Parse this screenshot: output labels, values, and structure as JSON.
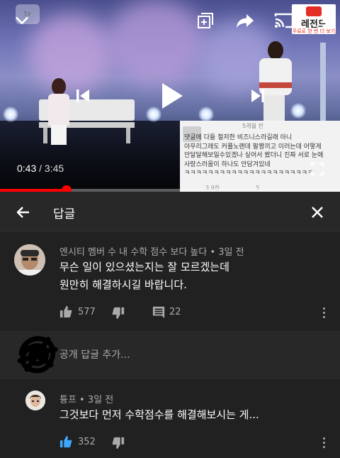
{
  "player": {
    "channel_logo_text": "tv",
    "channel_badge": {
      "name": "레전드",
      "sub": "무료로 한 번 더 보기"
    },
    "current_time": "0:43",
    "separator": " / ",
    "duration": "3:45",
    "progress_fraction": 0.196,
    "icons": {
      "collapse": "chevron-down-icon",
      "add_to_playlist": "playlist-add-icon",
      "share": "share-icon",
      "cast": "cast-icon",
      "more": "more-vertical-icon",
      "previous": "skip-previous-icon",
      "play": "play-icon",
      "next": "skip-next-icon",
      "fullscreen": "fullscreen-icon"
    },
    "screenshot_comment": {
      "time": "5개월 전",
      "lines": [
        "댓글에 다들 철저한 비즈니스라길래 아니",
        "아무리그래도 커플노랜데 팔짱끼고 이러는데 어떻게",
        "안달달해보일수있겠나 싶어서 봤더니 진짜 서로 눈에",
        "사랑스러움이 하나도 안담겨있네",
        "ㅋㅋㅋㅋㅋㅋㅋㅋㅋㅋㅋㅋㅋㅋㅋㅋㅋㅋㅋㅋㅋㅋ"
      ],
      "likes": "3.9천",
      "replies": "5"
    }
  },
  "reply_panel": {
    "title": "답글",
    "back_icon": "back-arrow-icon",
    "close_icon": "close-icon"
  },
  "top_comment": {
    "author": "엔시티 멤버 수 내 수학 점수 보다 높다",
    "time": "3일 전",
    "meta_sep": " • ",
    "lines": [
      "무슨 일이 있으셨는지는 잘 모르겠는데",
      "원만히 해결하시길 바랍니다."
    ],
    "likes": "577",
    "replies": "22"
  },
  "add_reply": {
    "placeholder": "공개 답글 추가..."
  },
  "reply": {
    "author": "튱프",
    "time": "3일 전",
    "meta_sep": " • ",
    "text": "그것보다 먼저 수학점수를 해결해보시는 게...",
    "likes": "352"
  },
  "colors": {
    "accent": "#ff0000",
    "like_active": "#3ea6ff",
    "panel_bg": "#212121"
  }
}
